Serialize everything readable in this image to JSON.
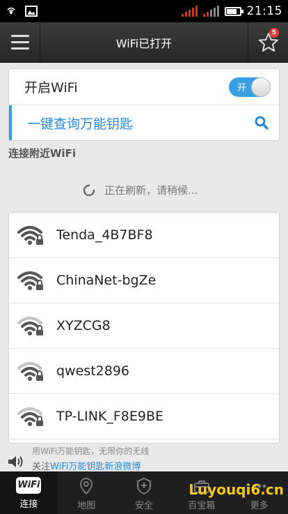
{
  "status_bar": {
    "time": "21:15",
    "battery_level": 0.8
  },
  "title_bar": {
    "title": "WiFi已打开",
    "favorites_badge": "5"
  },
  "wifi_toggle": {
    "label": "开启WiFi",
    "state_label": "开"
  },
  "key_lookup": {
    "label": "一键查询万能钥匙"
  },
  "nearby": {
    "title": "连接附近WiFi",
    "refresh_text": "正在刷新，请稍候...",
    "networks": [
      {
        "ssid": "Tenda_4B7BF8"
      },
      {
        "ssid": "ChinaNet-bgZe"
      },
      {
        "ssid": "XYZCG8"
      },
      {
        "ssid": "qwest2896"
      },
      {
        "ssid": "TP-LINK_F8E9BE"
      }
    ]
  },
  "marquee": {
    "line1": "用WiFi万能钥匙，无限你的无线",
    "line2_prefix": "关注",
    "line2_link": "WiFi万能钥匙新浪微博"
  },
  "bottom_nav": {
    "tabs": [
      {
        "label": "连接",
        "logo": "WiFi",
        "icon": "wifi-icon"
      },
      {
        "label": "地图",
        "icon": "map-pin-icon"
      },
      {
        "label": "安全",
        "icon": "shield-icon"
      },
      {
        "label": "百宝箱",
        "icon": "toolbox-icon"
      },
      {
        "label": "更多",
        "icon": "more-icon"
      }
    ]
  },
  "watermark": {
    "text": "Luyouqi6.cn"
  }
}
